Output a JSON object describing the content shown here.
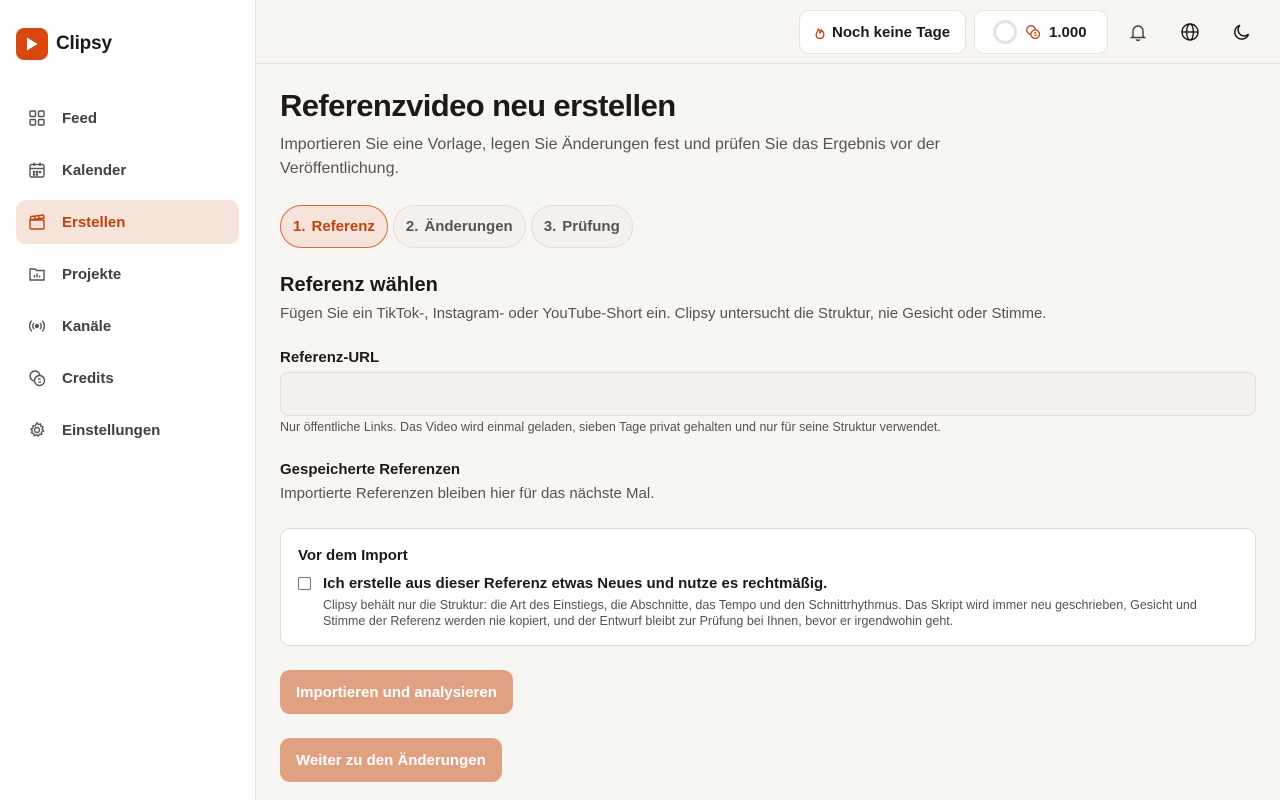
{
  "app": {
    "name": "Clipsy"
  },
  "sidebar": {
    "items": [
      {
        "label": "Feed",
        "icon": "grid-icon"
      },
      {
        "label": "Kalender",
        "icon": "calendar-icon"
      },
      {
        "label": "Erstellen",
        "icon": "clapperboard-icon",
        "active": true
      },
      {
        "label": "Projekte",
        "icon": "folder-chart-icon"
      },
      {
        "label": "Kanäle",
        "icon": "broadcast-icon"
      },
      {
        "label": "Credits",
        "icon": "coins-icon"
      },
      {
        "label": "Einstellungen",
        "icon": "gear-icon"
      }
    ]
  },
  "topbar": {
    "streak_label": "Noch keine Tage",
    "credits_value": "1.000"
  },
  "page": {
    "title": "Referenzvideo neu erstellen",
    "subtitle": "Importieren Sie eine Vorlage, legen Sie Änderungen fest und prüfen Sie das Ergebnis vor der Veröffentlichung."
  },
  "steps": [
    {
      "number": "1.",
      "label": "Referenz",
      "active": true
    },
    {
      "number": "2.",
      "label": "Änderungen"
    },
    {
      "number": "3.",
      "label": "Prüfung"
    }
  ],
  "reference": {
    "title": "Referenz wählen",
    "description": "Fügen Sie ein TikTok-, Instagram- oder YouTube-Short ein. Clipsy untersucht die Struktur, nie Gesicht oder Stimme.",
    "url_label": "Referenz-URL",
    "url_value": "",
    "url_hint": "Nur öffentliche Links. Das Video wird einmal geladen, sieben Tage privat gehalten und nur für seine Struktur verwendet.",
    "saved_title": "Gespeicherte Referenzen",
    "saved_description": "Importierte Referenzen bleiben hier für das nächste Mal."
  },
  "consent": {
    "title": "Vor dem Import",
    "checkbox_label": "Ich erstelle aus dieser Referenz etwas Neues und nutze es rechtmäßig.",
    "checked": false,
    "details": "Clipsy behält nur die Struktur: die Art des Einstiegs, die Abschnitte, das Tempo und den Schnittrhythmus. Das Skript wird immer neu geschrieben, Gesicht und Stimme der Referenz werden nie kopiert, und der Entwurf bleibt zur Prüfung bei Ihnen, bevor er irgendwohin geht."
  },
  "actions": {
    "import_label": "Importieren und analysieren",
    "next_label": "Weiter zu den Änderungen"
  },
  "colors": {
    "accent": "#c2410c",
    "brand": "#d9480f",
    "active_bg": "#f6e3da",
    "button_disabled": "#e0a183"
  }
}
